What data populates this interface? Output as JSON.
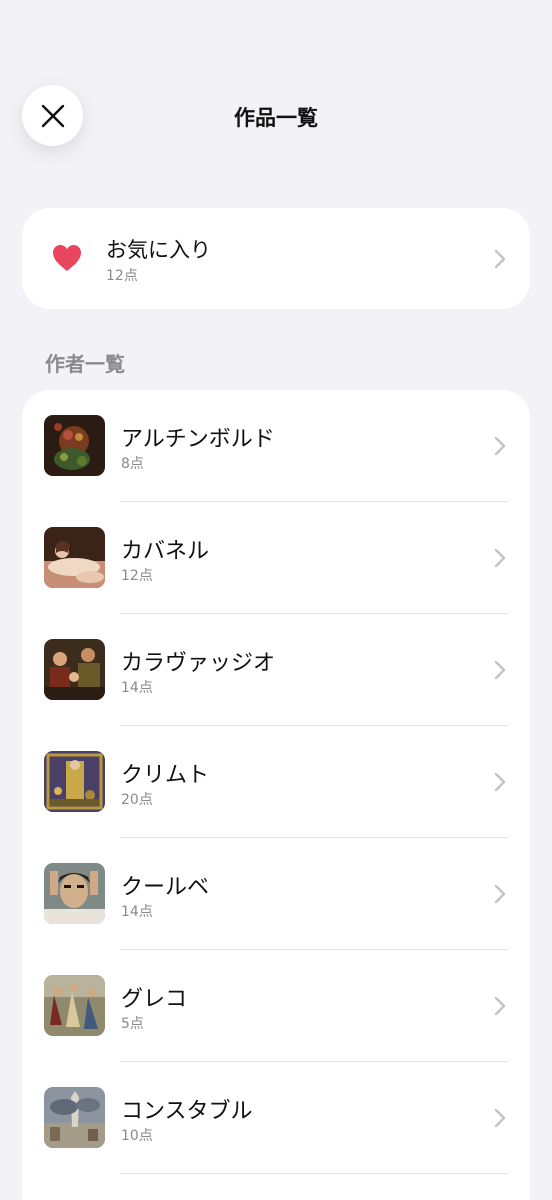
{
  "header": {
    "title": "作品一覧",
    "close_icon": "close-icon"
  },
  "favorites": {
    "label": "お気に入り",
    "count": "12点",
    "icon": "heart-icon",
    "icon_color": "#e8455f"
  },
  "section": {
    "title": "作者一覧"
  },
  "artists": [
    {
      "name": "アルチンボルド",
      "count": "8点"
    },
    {
      "name": "カバネル",
      "count": "12点"
    },
    {
      "name": "カラヴァッジオ",
      "count": "14点"
    },
    {
      "name": "クリムト",
      "count": "20点"
    },
    {
      "name": "クールベ",
      "count": "14点"
    },
    {
      "name": "グレコ",
      "count": "5点"
    },
    {
      "name": "コンスタブル",
      "count": "10点"
    }
  ],
  "colors": {
    "background": "#f2f2f7",
    "card": "#ffffff",
    "secondary_text": "#8a8a8e",
    "chevron": "#c4c4c7"
  }
}
